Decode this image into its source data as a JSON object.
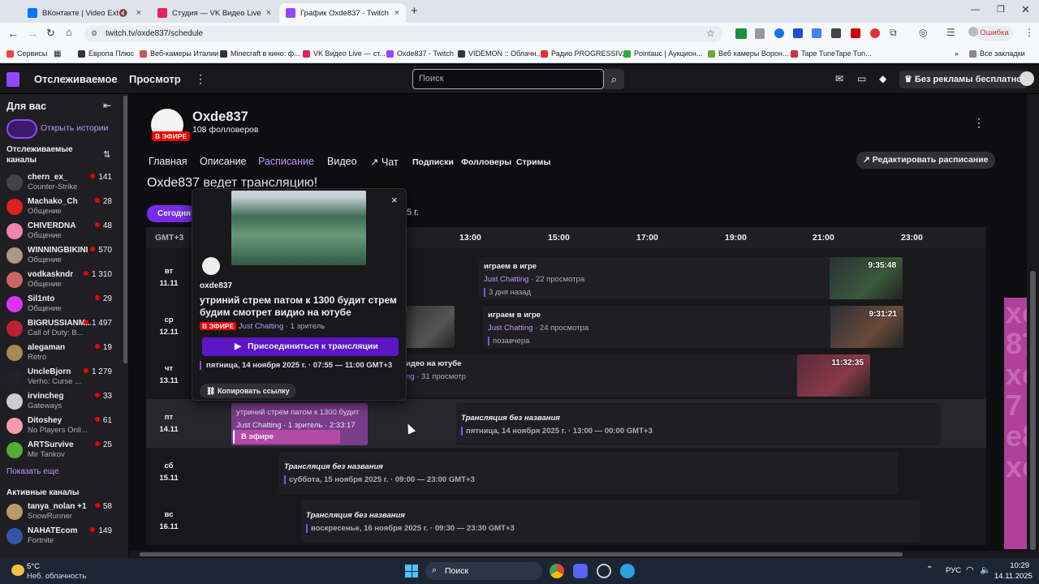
{
  "browser": {
    "tabs": [
      {
        "title": "ВКонтакте | Video Ext",
        "color": "#0077ff"
      },
      {
        "title": "Студия — VK Видео Live",
        "color": "#e0245e"
      },
      {
        "title": "График Oxde837 - Twitch",
        "color": "#9147ff"
      }
    ],
    "url": "twitch.tv/oxde837/schedule",
    "error_label": "Ошибка",
    "bookmarks": [
      "Сервисы",
      "Европа Плюс",
      "Веб-камеры Италии",
      "Minecraft в кино: ф...",
      "VK Видео Live — ст...",
      "Oxde837 - Twitch",
      "VIDEMON :: Облачн...",
      "Радио PROGRESSIV...",
      "Pointauc | Аукцион...",
      "Веб камеры Ворон...",
      "Tape TuneTape Tun..."
    ],
    "all_bookmarks": "Все закладки"
  },
  "nav": {
    "following": "Отслеживаемое",
    "browse": "Просмотр",
    "search_placeholder": "Поиск",
    "ad_free": "Без рекламы бесплатно"
  },
  "sidebar": {
    "for_you": "Для вас",
    "open_stories": "Открыть истории",
    "followed_channels": "Отслеживаемые каналы",
    "channels": [
      {
        "name": "chern_ex_",
        "game": "Counter-Strike",
        "viewers": "141",
        "color": "#444"
      },
      {
        "name": "Machako_Ch",
        "game": "Общение",
        "viewers": "28",
        "color": "#d22"
      },
      {
        "name": "CHIVERDNA",
        "game": "Общение",
        "viewers": "48",
        "color": "#e8a"
      },
      {
        "name": "WINNINGBIKINI",
        "game": "Общение",
        "viewers": "570",
        "color": "#a98"
      },
      {
        "name": "vodkaskndr",
        "game": "Общение",
        "viewers": "1 310",
        "color": "#c66"
      },
      {
        "name": "Sil1nto",
        "game": "Общение",
        "viewers": "29",
        "color": "#d3f"
      },
      {
        "name": "BIGRUSSIANM...",
        "game": "Call of Duty: B...",
        "viewers": "1 497",
        "color": "#b23"
      },
      {
        "name": "alegaman",
        "game": "Retro",
        "viewers": "19",
        "color": "#a85"
      },
      {
        "name": "UncleBjorn",
        "game": "Verho: Curse ...",
        "viewers": "1 279",
        "color": "#222"
      },
      {
        "name": "irvincheg",
        "game": "Gateways",
        "viewers": "33",
        "color": "#ccc"
      },
      {
        "name": "Ditoshey",
        "game": "No Players Onli...",
        "viewers": "61",
        "color": "#f9a"
      },
      {
        "name": "ARTSurvive",
        "game": "Mir Tankov",
        "viewers": "25",
        "color": "#5a3"
      }
    ],
    "show_more": "Показать еще",
    "active_channels": "Активные каналы",
    "active": [
      {
        "name": "tanya_nolan +1",
        "game": "SnowRunner",
        "viewers": "58",
        "color": "#b96"
      },
      {
        "name": "NAHATEcom",
        "game": "Fortnite",
        "viewers": "149",
        "color": "#35a"
      }
    ]
  },
  "channel": {
    "name": "Oxde837",
    "followers": "108 фолловеров",
    "live_badge": "В ЭФИРЕ",
    "tabs": [
      "Главная",
      "Описание",
      "Расписание",
      "Видео",
      "Чат"
    ],
    "subtabs": [
      "Подписки",
      "Фолловеры",
      "Стримы"
    ],
    "edit_schedule": "Редактировать расписание",
    "live_heading": "Oxde837 ведет трансляцию!",
    "today_button": "Сегодня",
    "date_fragment": "5 г."
  },
  "schedule": {
    "timezone": "GMT+3",
    "hours": [
      "13:00",
      "15:00",
      "17:00",
      "19:00",
      "21:00",
      "23:00"
    ],
    "days": [
      {
        "dow": "вт",
        "date": "11.11"
      },
      {
        "dow": "ср",
        "date": "12.11"
      },
      {
        "dow": "чт",
        "date": "13.11"
      },
      {
        "dow": "пт",
        "date": "14.11"
      },
      {
        "dow": "сб",
        "date": "15.11"
      },
      {
        "dow": "вс",
        "date": "16.11"
      }
    ],
    "past": [
      {
        "title": "играем в игре",
        "category": "Just Chatting",
        "views": "22 просмотра",
        "ago": "3 дня назад",
        "duration": "9:35:48"
      },
      {
        "title": "играем в игре",
        "category": "Just Chatting",
        "views": "24 просмотра",
        "ago": "позавчера",
        "duration": "9:31:21"
      },
      {
        "title": "идео на ютубе",
        "category": "ng",
        "views": "31 просмотр",
        "duration": "11:32:35"
      }
    ],
    "live_event": {
      "title": "утриний стрем патом к 1300 будит",
      "meta": "Just Chatting · 1 зритель · 2:33:17",
      "badge": "В эфире"
    },
    "planned": [
      {
        "title": "Трансляция без названия",
        "when": "пятница, 14 ноября 2025 г. · 13:00 — 00:00 GMT+3"
      },
      {
        "title": "Трансляция без названия",
        "when": "суббота, 15 ноября 2025 г. · 09:00 — 23:00 GMT+3"
      },
      {
        "title": "Трансляция без названия",
        "when": "воскресенье, 16 ноября 2025 г. · 09:30 — 23:30 GMT+3"
      }
    ]
  },
  "popup": {
    "channel": "oxde837",
    "title": "утриний стрем патом к 1300 будит стрем будим смотрет видио на ютубе",
    "live": "В ЭФИРЕ",
    "category": "Just Chatting",
    "viewers": "1 зритель",
    "join": "Присоединиться к трансляции",
    "when": "пятница, 14 ноября 2025 г. · 07:55 — 11:00 GMT+3",
    "copy_link": "Копировать ссылку"
  },
  "taskbar": {
    "weather_temp": "5°C",
    "weather_desc": "Неб. облачность",
    "search": "Поиск",
    "lang": "РУС",
    "time": "10:29",
    "date": "14.11.2025"
  }
}
